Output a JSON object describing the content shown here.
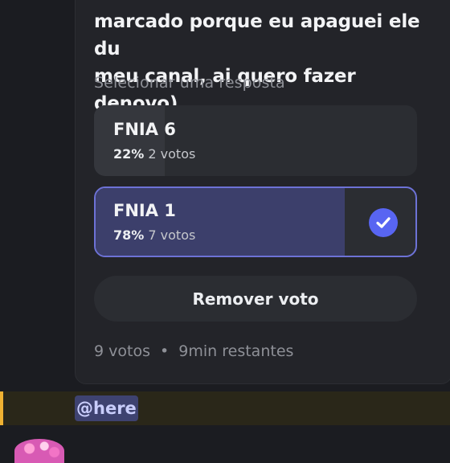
{
  "poll": {
    "question_lines": [
      "marcado porque eu apaguei ele du",
      "meu canal, ai quero fazer denovo)"
    ],
    "select_hint": "Selecionar uma resposta",
    "options": [
      {
        "label": "FNIA 6",
        "percent": "22%",
        "votes": "2 votos",
        "fraction": 0.22,
        "selected": false
      },
      {
        "label": "FNIA 1",
        "percent": "78%",
        "votes": "7 votos",
        "fraction": 0.78,
        "selected": true
      }
    ],
    "remove_vote_label": "Remover voto",
    "total_votes": "9 votos",
    "separator": "•",
    "time_left": "9min restantes"
  },
  "message": {
    "mention": "@here"
  },
  "colors": {
    "accent": "#5865f2",
    "mention_highlight": "#f0b232"
  }
}
